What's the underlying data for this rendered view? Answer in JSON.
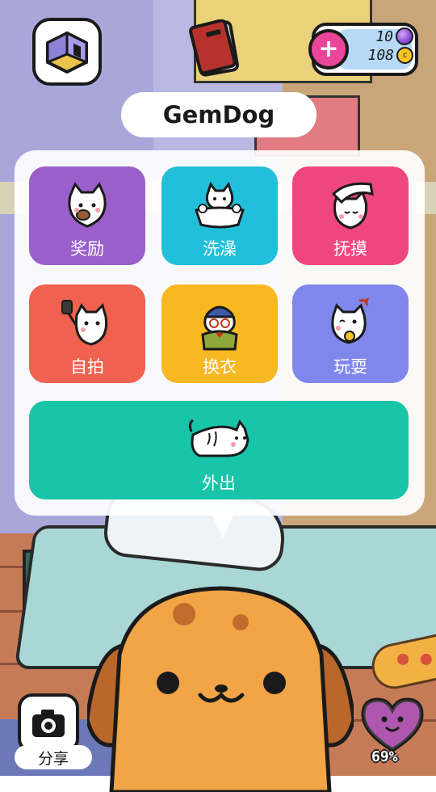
{
  "pet": {
    "name": "GemDog"
  },
  "currency": {
    "gems": "10",
    "coins": "108",
    "coin_symbol": "c",
    "add_label": "+"
  },
  "menu": {
    "actions": [
      {
        "label": "奖励",
        "icon": "reward-cat-icon",
        "color": "#9a5fcb"
      },
      {
        "label": "洗澡",
        "icon": "bath-cat-icon",
        "color": "#22bfdb"
      },
      {
        "label": "抚摸",
        "icon": "pet-cat-icon",
        "color": "#f0467f"
      },
      {
        "label": "自拍",
        "icon": "selfie-cat-icon",
        "color": "#f0614f"
      },
      {
        "label": "换衣",
        "icon": "dress-up-cat-icon",
        "color": "#f7b822"
      },
      {
        "label": "玩耍",
        "icon": "play-cat-icon",
        "color": "#7f86ec"
      },
      {
        "label": "外出",
        "icon": "go-out-cat-icon",
        "color": "#18c5a8"
      }
    ]
  },
  "share": {
    "label": "分享"
  },
  "happiness": {
    "percent_label": "69%",
    "value": 0.69
  }
}
